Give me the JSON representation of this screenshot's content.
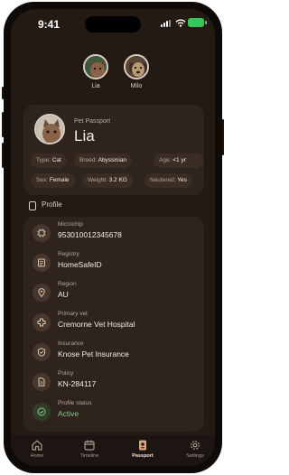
{
  "status_bar": {
    "time": "9:41"
  },
  "pet_switcher": [
    {
      "name": "Lia",
      "active": true
    },
    {
      "name": "Milo",
      "active": false
    }
  ],
  "passport": {
    "label": "Pet Passport",
    "name": "Lia",
    "attributes": [
      {
        "key": "Type:",
        "value": "Cat"
      },
      {
        "key": "Breed:",
        "value": "Abyssinian"
      },
      {
        "key": "Age:",
        "value": "<1 yr"
      },
      {
        "key": "Sex:",
        "value": "Female"
      },
      {
        "key": "Weight:",
        "value": "3.2 KG"
      },
      {
        "key": "Neutered:",
        "value": "Yes"
      }
    ]
  },
  "profile": {
    "title": "Profile",
    "rows": [
      {
        "label": "Microchip",
        "value": "953010012345678",
        "icon": "microchip-icon"
      },
      {
        "label": "Registry",
        "value": "HomeSafeID",
        "icon": "registry-icon"
      },
      {
        "label": "Region",
        "value": "AU",
        "icon": "location-pin-icon"
      },
      {
        "label": "Primary vet",
        "value": "Cremorne Vet Hospital",
        "icon": "vet-icon"
      },
      {
        "label": "Insurance",
        "value": "Knose Pet Insurance",
        "icon": "shield-icon"
      },
      {
        "label": "Policy",
        "value": "KN-284117",
        "icon": "document-icon"
      },
      {
        "label": "Profile status",
        "value": "Active",
        "icon": "check-circle-icon"
      }
    ]
  },
  "tabs": [
    {
      "label": "Home",
      "icon": "home-icon",
      "active": false
    },
    {
      "label": "Timeline",
      "icon": "calendar-icon",
      "active": false
    },
    {
      "label": "Passport",
      "icon": "passport-icon",
      "active": true
    },
    {
      "label": "Settings",
      "icon": "gear-icon",
      "active": false
    }
  ],
  "colors": {
    "background": "#231a14",
    "card": "#2f241d",
    "chip": "#3a2d24",
    "status_active": "#88c88a",
    "battery": "#34c759"
  }
}
